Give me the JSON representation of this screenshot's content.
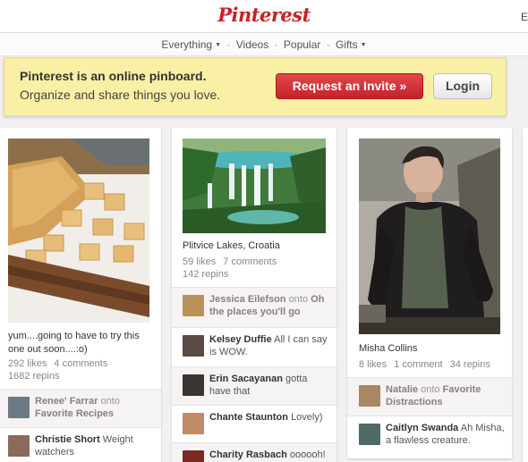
{
  "header": {
    "logo": "Pinterest",
    "edge_letter": "E"
  },
  "nav": {
    "items": [
      "Everything",
      "Videos",
      "Popular",
      "Gifts"
    ],
    "separator": "·"
  },
  "banner": {
    "line1": "Pinterest is an online pinboard.",
    "line2": "Organize and share things you love.",
    "invite_label": "Request an Invite »",
    "login_label": "Login"
  },
  "pins": [
    {
      "description": "yum....going to have to try this one out soon....:o)",
      "likes": "292 likes",
      "comments": "4 comments",
      "repins": "1682 repins",
      "activity": [
        {
          "name": "Renee' Farrar",
          "verb": "onto",
          "board": "Favorite Recipes"
        },
        {
          "name": "Christie Short",
          "text": "Weight watchers"
        }
      ]
    },
    {
      "description": "Plitvice Lakes, Croatia",
      "likes": "59 likes",
      "comments": "7 comments",
      "repins": "142 repins",
      "activity": [
        {
          "name": "Jessica Eilefson",
          "verb": "onto",
          "board": "Oh the places you'll go"
        },
        {
          "name": "Kelsey Duffie",
          "text": "All I can say is WOW."
        },
        {
          "name": "Erin Sacayanan",
          "text": "gotta have that"
        },
        {
          "name": "Chante Staunton",
          "text": "Lovely)"
        },
        {
          "name": "Charity Rasbach",
          "text": "oooooh!"
        }
      ]
    },
    {
      "description": "Misha Collins",
      "likes": "8 likes",
      "comments": "1 comment",
      "repins": "34 repins",
      "activity": [
        {
          "name": "Natalie",
          "verb": "onto",
          "board": "Favorite Distractions"
        },
        {
          "name": "Caitlyn Swanda",
          "text": "Ah Misha, a flawless creature."
        }
      ]
    }
  ]
}
